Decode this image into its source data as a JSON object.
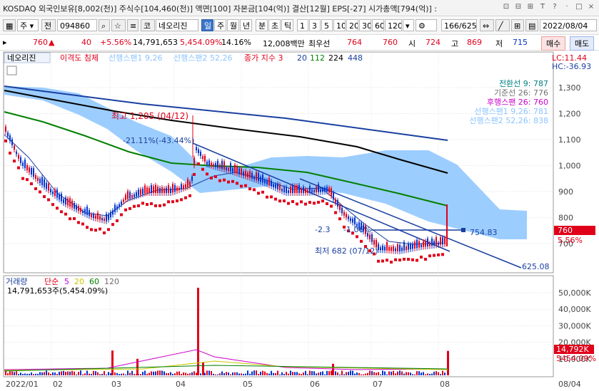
{
  "window": {
    "title": "KOSDAQ 외국인보유[8,002(천)] 주식수[104,460(천)] 액면[100] 자본금[104(억)] 결산[12월] EPS[-27] 시가총액[794(억)] :",
    "controls": [
      "⊡",
      "⊟",
      "⊞",
      "T",
      "?",
      "·",
      "□",
      "×"
    ]
  },
  "toolbar": {
    "market": "주",
    "type": "전",
    "code": "094860",
    "kosdaq_label": "코",
    "stock_name": "네오리진",
    "periods": [
      "일",
      "주",
      "월",
      "년",
      "분",
      "초",
      "틱"
    ],
    "selected_period": "일",
    "intervals": [
      "1",
      "3",
      "5",
      "10",
      "20",
      "30",
      "60",
      "120"
    ],
    "count": "166",
    "total": "/625",
    "date": "2022/08/04"
  },
  "info": {
    "price": "760",
    "change": "40",
    "change_pct": "+5.56%",
    "volume": "14,791,653",
    "volume_pct": "5,454.09%",
    "turnover": "14.16%",
    "amount": "12,008백만",
    "best_label": "최우선",
    "ask": "764",
    "bid": "760",
    "open_label": "시",
    "open": "724",
    "high_label": "고",
    "high": "869",
    "low_label": "저",
    "low": "715",
    "buy_btn": "매수",
    "sell_btn": "매도"
  },
  "price_panel": {
    "stock_label": "네오리진",
    "indicator_name": "이격도 침체",
    "legend": [
      {
        "text": "선행스팬1 9,26",
        "color": "#8bc4ff"
      },
      {
        "text": "선행스팬2 52,26",
        "color": "#8bc4ff"
      },
      {
        "text": "종가 지수 3",
        "color": "#e0001a"
      },
      {
        "text": "20",
        "color": "#1a3fa0"
      },
      {
        "text": "112",
        "color": "#008000"
      },
      {
        "text": "224",
        "color": "#000000"
      },
      {
        "text": "448",
        "color": "#1a3fa0"
      }
    ],
    "lc": "LC:11.44",
    "hc": "HC:-36.93",
    "right_legend": [
      {
        "text": "전환선 9: 787",
        "color": "#008080"
      },
      {
        "text": "기준선 26: 776",
        "color": "#707070"
      },
      {
        "text": "후행스팬 26: 760",
        "color": "#cc00cc"
      },
      {
        "text": "선행스팬1 9,26: 781",
        "color": "#8bc4ff"
      },
      {
        "text": "선행스팬2 52,26: 838",
        "color": "#8bc4ff"
      }
    ],
    "annot_high": "최고 1,205 (04/12)",
    "annot_low": "최저 682 (07/12)",
    "annot_trend1": "-21.11%(-43.44%)",
    "annot_trend2": "-2.3",
    "annot_trend2b": "-1.06%",
    "line_754": "754.83",
    "line_625": "625.08",
    "current_price": "760",
    "current_pct": "5.56%",
    "y_ticks": [
      "1,300",
      "1,200",
      "1,100",
      "1,000",
      "900",
      "800",
      "700"
    ]
  },
  "volume_panel": {
    "title": "거래량",
    "ma_label": "단순",
    "mas": [
      {
        "text": "5",
        "color": "#cc00cc"
      },
      {
        "text": "20",
        "color": "#c8c800"
      },
      {
        "text": "60",
        "color": "#008000"
      },
      {
        "text": "120",
        "color": "#707070"
      }
    ],
    "value_text": "14,791,653주(5,454.09%)",
    "current": "14,792K",
    "current_pct": "5454.09%",
    "y_ticks": [
      "50,000K",
      "40,000K",
      "30,000K",
      "20,000K",
      "10,000K"
    ]
  },
  "x_axis": [
    "2022/01",
    "02",
    "03",
    "04",
    "05",
    "06",
    "07",
    "08",
    "08/04"
  ],
  "colors": {
    "up": "#e0001a",
    "down": "#0033cc",
    "accent": "#3b74c9"
  }
}
